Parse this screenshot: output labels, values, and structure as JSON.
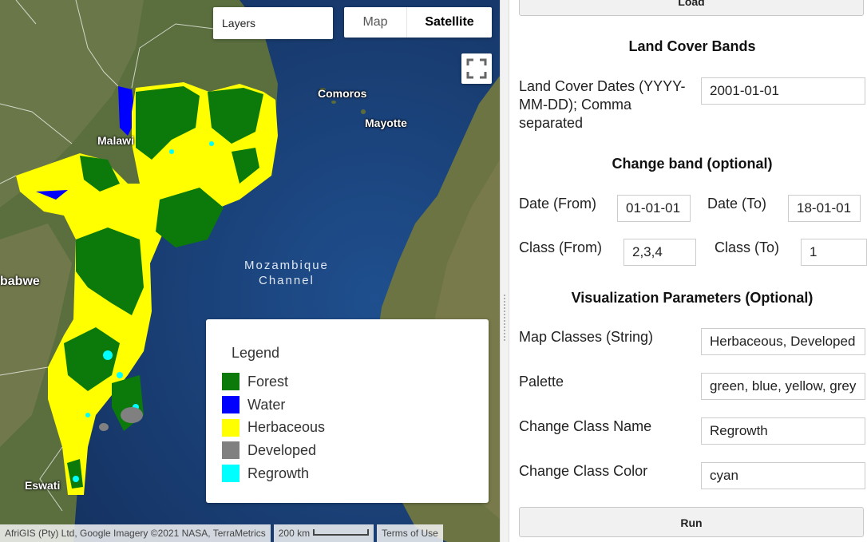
{
  "map": {
    "layers_label": "Layers",
    "map_type_tabs": [
      "Map",
      "Satellite"
    ],
    "selected_map_type": "Satellite",
    "place_labels": {
      "comoros": "Comoros",
      "mayotte": "Mayotte",
      "malawi": "Malawi",
      "zimbabwe": "babwe",
      "eswatini": "Eswati",
      "channel_line1": "Mozambique",
      "channel_line2": "Channel"
    },
    "legend": {
      "title": "Legend",
      "items": [
        {
          "label": "Forest",
          "color": "#0b7a0b"
        },
        {
          "label": "Water",
          "color": "#0000ff"
        },
        {
          "label": "Herbaceous",
          "color": "#ffff00"
        },
        {
          "label": "Developed",
          "color": "#808080"
        },
        {
          "label": "Regrowth",
          "color": "#00ffff"
        }
      ]
    },
    "attribution": "AfriGIS (Pty) Ltd, Google Imagery ©2021 NASA, TerraMetrics",
    "scale_label": "200 km",
    "terms": "Terms of Use"
  },
  "panel": {
    "load_button": "Load",
    "land_cover_title": "Land Cover Bands",
    "land_cover_dates_label": "Land Cover Dates (YYYY-MM-DD); Comma separated",
    "land_cover_dates_value": "2001-01-01",
    "change_band_title": "Change band (optional)",
    "date_from_label": "Date (From)",
    "date_from_value": "01-01-01",
    "date_to_label": "Date (To)",
    "date_to_value": "18-01-01",
    "class_from_label": "Class (From)",
    "class_from_value": "2,3,4",
    "class_to_label": "Class (To)",
    "class_to_value": "1",
    "vis_title": "Visualization Parameters (Optional)",
    "map_classes_label": "Map Classes (String)",
    "map_classes_value": "Herbaceous, Developed",
    "palette_label": "Palette",
    "palette_value": "green, blue, yellow, grey",
    "change_class_name_label": "Change Class Name",
    "change_class_name_value": "Regrowth",
    "change_class_color_label": "Change Class Color",
    "change_class_color_value": "cyan",
    "run_button": "Run"
  }
}
